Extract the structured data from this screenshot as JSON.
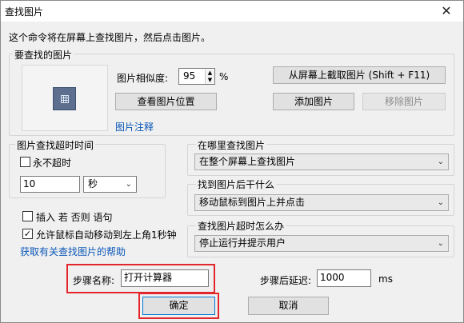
{
  "window": {
    "title": "查找图片",
    "close_glyph": "✕"
  },
  "intro": "这个命令将在屏幕上查找图片，然后点击图片。",
  "image_group": {
    "legend": "要查找的图片",
    "similarity_label": "图片相似度:",
    "similarity_value": "95",
    "percent": "%",
    "view_location_button": "查看图片位置",
    "note_link": "图片注释",
    "capture_button": "从屏幕上截取图片 (Shift + F11)",
    "add_button": "添加图片",
    "remove_button": "移除图片"
  },
  "timeout_group": {
    "legend": "图片查找超时时间",
    "never_timeout_label": "永不超时",
    "never_timeout_checked": false,
    "timeout_value": "10",
    "unit_selected": "秒"
  },
  "options": {
    "insert_if_else_label": "插入 若 否则 语句",
    "insert_if_else_checked": false,
    "allow_mouse_move_label": "允许鼠标自动移动到左上角1秒钟",
    "allow_mouse_move_checked": true,
    "help_link": "获取有关查找图片的帮助"
  },
  "where": {
    "label": "在哪里查找图片",
    "selected": "在整个屏幕上查找图片"
  },
  "after_found": {
    "label": "找到图片后干什么",
    "selected": "移动鼠标到图片上并点击"
  },
  "on_timeout": {
    "label": "查找图片超时怎么办",
    "selected": "停止运行并提示用户"
  },
  "step": {
    "name_label": "步骤名称:",
    "name_value": "打开计算器",
    "delay_label": "步骤后延迟:",
    "delay_value": "1000",
    "delay_unit": "ms"
  },
  "footer": {
    "ok_button": "确定",
    "cancel_button": "取消"
  },
  "colors": {
    "highlight_red": "#e3262b",
    "link_blue": "#0b57b7",
    "dialog_bg": "#f0f0f0"
  },
  "icons": {
    "close": "close-icon",
    "checkbox_check": "check-icon",
    "dropdown": "chevron-down-icon",
    "spin_up": "spin-up-icon",
    "spin_down": "spin-down-icon",
    "preview": "image-preview-icon"
  }
}
